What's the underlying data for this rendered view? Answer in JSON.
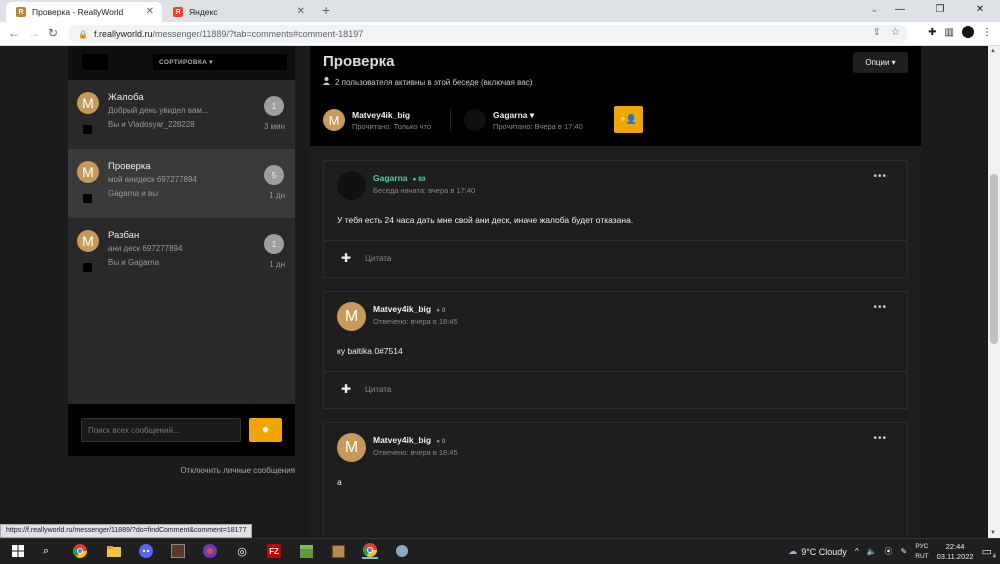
{
  "browser": {
    "tabs": [
      {
        "title": "Проверка - ReallyWorld",
        "favicon": "reallyworld-favicon",
        "active": true
      },
      {
        "title": "Яндекс",
        "favicon": "yandex-favicon",
        "active": false
      }
    ],
    "url_host": "f.reallyworld.ru",
    "url_path": "/messenger/11889/?tab=comments#comment-18197",
    "status_url": "https://f.reallyworld.ru/messenger/11889/?do=findComment&comment=18177"
  },
  "left": {
    "sort_label": "СОРТИРОВКА ▾",
    "conversations": [
      {
        "avatar_letter": "M",
        "title": "Жалоба",
        "preview": "Добрый день увидел вам...",
        "participants": "Вы и Vladosyar_228228",
        "count": "1",
        "time": "3 мин",
        "selected": false
      },
      {
        "avatar_letter": "M",
        "title": "Проверка",
        "preview": "мой анидеск 697277894",
        "participants": "Gagarna и вы",
        "count": "5",
        "time": "1 дн",
        "selected": true
      },
      {
        "avatar_letter": "M",
        "title": "Разбан",
        "preview": "ани деск 697277894",
        "participants": "Вы и Gagarna",
        "count": "1",
        "time": "1 дн",
        "selected": false
      }
    ],
    "search_placeholder": "Поиск всех сообщений...",
    "disable_pm_label": "Отключить личные сообщения"
  },
  "conversation": {
    "title": "Проверка",
    "options_label": "Опции ▾",
    "active_users_text": "2 пользователя активны в этой беседе (включая вас)",
    "participants": [
      {
        "name": "Matvey4ik_big",
        "avatar_letter": "M",
        "read": "Прочитано: Только что"
      },
      {
        "name": "Gagarna ▾",
        "avatar_letter": "",
        "read": "Прочитано: Вчера в 17:40"
      }
    ]
  },
  "messages": [
    {
      "author": "Gagarna",
      "author_color": "#4ad09a",
      "score": "89",
      "avatar_letter": "",
      "meta": "Беседа начата: вчера в 17:40",
      "text": "У тебя есть 24 часа дать мне свой ани деск, иначе жалоба будет отказана.",
      "quote_label": "Цитата"
    },
    {
      "author": "Matvey4ik_big",
      "author_color": "#eeeeee",
      "score": "0",
      "avatar_letter": "M",
      "meta": "Отвечено: вчера в 18:45",
      "text": "ку baltika 0#7514",
      "quote_label": "Цитата"
    },
    {
      "author": "Matvey4ik_big",
      "author_color": "#eeeeee",
      "score": "0",
      "avatar_letter": "M",
      "meta": "Отвечено: вчера в 18:45",
      "text": "а",
      "quote_label": ""
    }
  ],
  "taskbar": {
    "weather": "9°C  Cloudy",
    "lang_top": "РУС",
    "lang_bottom": "RUT",
    "time": "22:44",
    "date": "03.11.2022",
    "notifications": "4"
  },
  "colors": {
    "accent": "#f0a500",
    "online_green": "#4ad09a",
    "avatar_tan": "#c79a5a"
  }
}
